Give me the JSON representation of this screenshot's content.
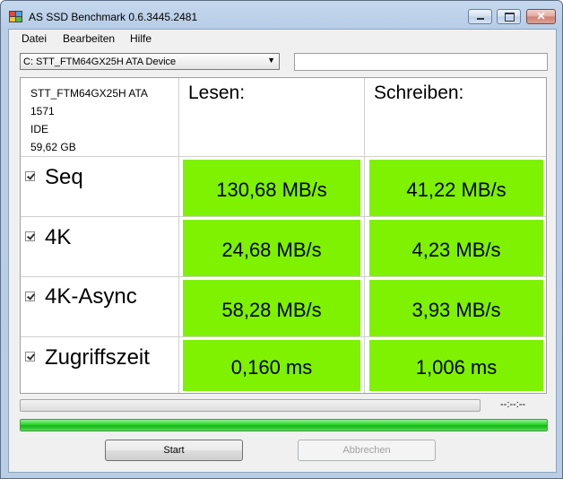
{
  "window": {
    "title": "AS SSD Benchmark 0.6.3445.2481"
  },
  "menu": {
    "items": [
      "Datei",
      "Bearbeiten",
      "Hilfe"
    ]
  },
  "device_select": {
    "value": "C: STT_FTM64GX25H ATA Device"
  },
  "drive_info": {
    "model": "STT_FTM64GX25H ATA",
    "firmware": "1571",
    "driver": "IDE",
    "size": "59,62 GB"
  },
  "columns": {
    "read": "Lesen:",
    "write": "Schreiben:"
  },
  "rows": [
    {
      "label": "Seq",
      "checked": true,
      "read": "130,68 MB/s",
      "write": "41,22 MB/s"
    },
    {
      "label": "4K",
      "checked": true,
      "read": "24,68 MB/s",
      "write": "4,23 MB/s"
    },
    {
      "label": "4K-Async",
      "checked": true,
      "read": "58,28 MB/s",
      "write": "3,93 MB/s"
    },
    {
      "label": "Zugriffszeit",
      "checked": true,
      "read": "0,160 ms",
      "write": "1,006 ms"
    }
  ],
  "progress": {
    "current_fraction": 0,
    "elapsed_text": "--:--:--",
    "total_fraction": 1
  },
  "buttons": {
    "start": "Start",
    "abort": "Abbrechen"
  },
  "colors": {
    "result_bg": "#7ef200",
    "progress_fill": "#22c922"
  }
}
